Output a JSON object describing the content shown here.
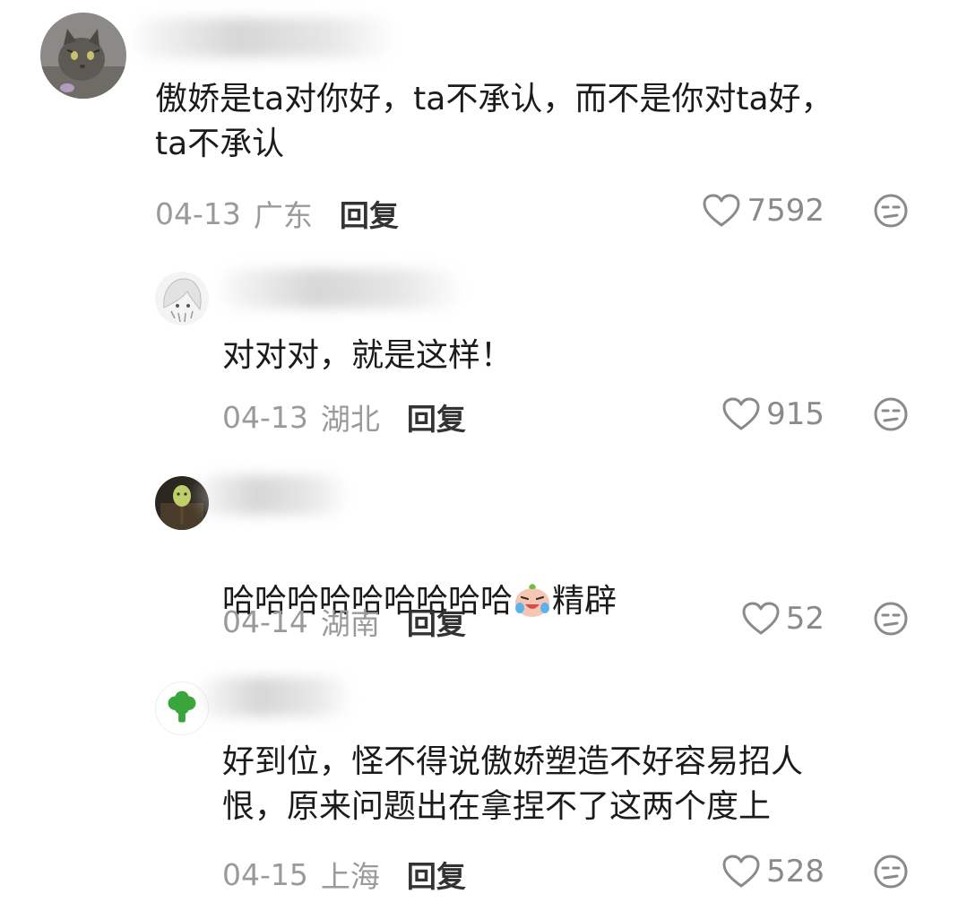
{
  "comments": [
    {
      "text": "傲娇是ta对你好，ta不承认，而不是你对ta好，\nta不承认",
      "date": "04-13",
      "region": "广东",
      "reply_label": "回复",
      "likes": "7592"
    },
    {
      "text": "对对对，就是这样！",
      "date": "04-13",
      "region": "湖北",
      "reply_label": "回复",
      "likes": "915"
    },
    {
      "text_before": "哈哈哈哈哈哈哈哈哈",
      "emoji": "crying-laughing-sticker-icon",
      "text_after": "精辟",
      "date": "04-14",
      "region": "湖南",
      "reply_label": "回复",
      "likes": "52"
    },
    {
      "text": "好到位，怪不得说傲娇塑造不好容易招人\n恨，原来问题出在拿捏不了这两个度上",
      "date": "04-15",
      "region": "上海",
      "reply_label": "回复",
      "likes": "528"
    }
  ],
  "colors": {
    "meta_gray": "#9a9a9a",
    "reply_dark": "#333333",
    "icon_gray": "#8a8a8a",
    "broccoli_green": "#3aa53a"
  }
}
